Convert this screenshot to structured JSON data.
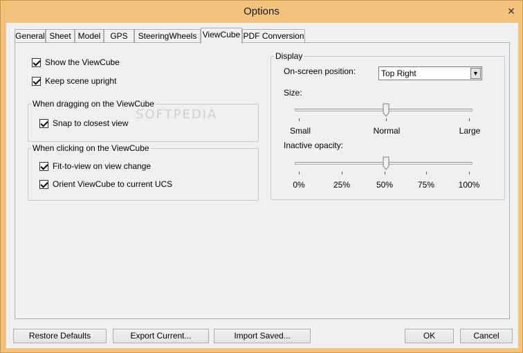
{
  "window": {
    "title": "Options",
    "close_glyph": "✕"
  },
  "tabs": [
    {
      "label": "General"
    },
    {
      "label": "Sheet"
    },
    {
      "label": "Model"
    },
    {
      "label": "GPS"
    },
    {
      "label": "SteeringWheels"
    },
    {
      "label": "ViewCube",
      "active": true
    },
    {
      "label": "PDF Conversion"
    }
  ],
  "left": {
    "show_viewcube": {
      "label": "Show the ViewCube",
      "checked": true
    },
    "keep_upright": {
      "label": "Keep scene upright",
      "checked": true
    },
    "dragging_group": {
      "title": "When dragging on the ViewCube",
      "snap": {
        "label": "Snap to closest view",
        "checked": true
      }
    },
    "clicking_group": {
      "title": "When clicking on the ViewCube",
      "fit": {
        "label": "Fit-to-view on view change",
        "checked": true
      },
      "orient": {
        "label": "Orient ViewCube to current UCS",
        "checked": true
      }
    }
  },
  "display": {
    "title": "Display",
    "position_label": "On-screen position:",
    "position_value": "Top Right",
    "size_label": "Size:",
    "size_ticks": [
      "Small",
      "Normal",
      "Large"
    ],
    "size_value": "Normal",
    "opacity_label": "Inactive opacity:",
    "opacity_ticks": [
      "0%",
      "25%",
      "50%",
      "75%",
      "100%"
    ],
    "opacity_value": 0.5
  },
  "watermark": "SOFTPEDIA",
  "buttons": {
    "restore": "Restore Defaults",
    "export": "Export Current...",
    "import": "Import Saved...",
    "ok": "OK",
    "cancel": "Cancel"
  }
}
